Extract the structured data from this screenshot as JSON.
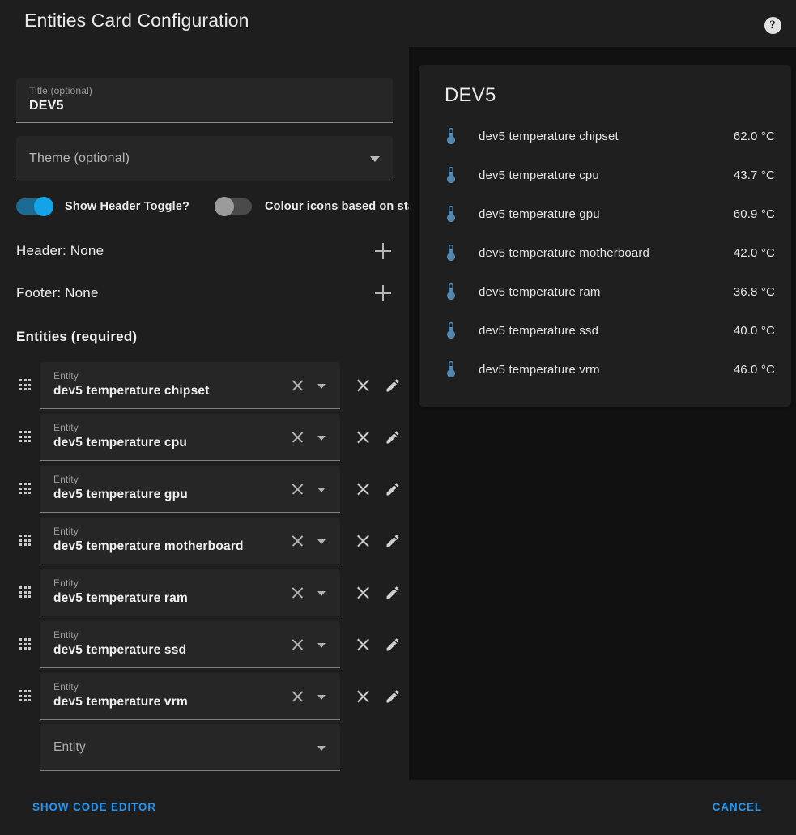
{
  "header": {
    "title": "Entities Card Configuration",
    "help_icon": "help-circle-icon",
    "help_glyph": "?"
  },
  "config": {
    "title_field": {
      "label": "Title (optional)",
      "value": "DEV5"
    },
    "theme_field": {
      "placeholder": "Theme (optional)",
      "value": "",
      "caret_icon": "chevron-down-icon"
    },
    "toggles": [
      {
        "label": "Show Header Toggle?",
        "state": "on"
      },
      {
        "label": "Colour icons based on state?",
        "state": "off"
      }
    ],
    "sections": [
      {
        "label": "Header: None",
        "add_icon": "plus-icon"
      },
      {
        "label": "Footer: None",
        "add_icon": "plus-icon"
      }
    ],
    "entities_heading": "Entities (required)",
    "entity_field_label": "Entity",
    "entity_rows": [
      {
        "value": "dev5 temperature chipset"
      },
      {
        "value": "dev5 temperature cpu"
      },
      {
        "value": "dev5 temperature gpu"
      },
      {
        "value": "dev5 temperature motherboard"
      },
      {
        "value": "dev5 temperature ram"
      },
      {
        "value": "dev5 temperature ssd"
      },
      {
        "value": "dev5 temperature vrm"
      }
    ],
    "empty_row_placeholder": "Entity",
    "row_icons": {
      "drag": "drag-handle-icon",
      "clear": "clear-icon",
      "caret": "chevron-down-icon",
      "remove": "close-icon",
      "edit": "pencil-icon"
    }
  },
  "actions": {
    "show_code_editor": "SHOW CODE EDITOR",
    "cancel": "CANCEL"
  },
  "preview": {
    "card_title": "DEV5",
    "icon_name": "thermometer-icon",
    "icon_color": "#5288b0",
    "rows": [
      {
        "name": "dev5 temperature chipset",
        "value": "62.0 °C"
      },
      {
        "name": "dev5 temperature cpu",
        "value": "43.7 °C"
      },
      {
        "name": "dev5 temperature gpu",
        "value": "60.9 °C"
      },
      {
        "name": "dev5 temperature motherboard",
        "value": "42.0 °C"
      },
      {
        "name": "dev5 temperature ram",
        "value": "36.8 °C"
      },
      {
        "name": "dev5 temperature ssd",
        "value": "40.0 °C"
      },
      {
        "name": "dev5 temperature vrm",
        "value": "46.0 °C"
      }
    ]
  },
  "colors": {
    "accent": "#2196f3",
    "toggle_on_knob": "#15a3e8",
    "toggle_on_track": "#1a6a94",
    "page_bg": "#1e1e1e",
    "preview_bg": "#111111",
    "card_bg": "#1f1f1f",
    "field_bg": "#262626"
  }
}
